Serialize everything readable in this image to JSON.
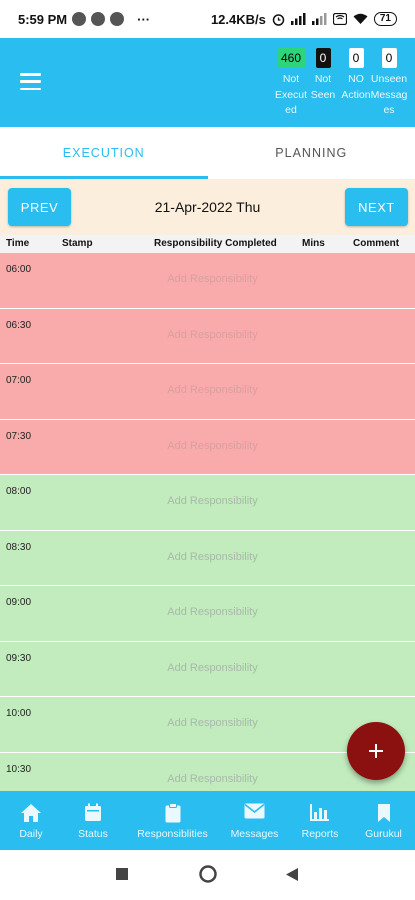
{
  "status_bar": {
    "time": "5:59 PM",
    "more": "···",
    "network_speed": "12.4KB/s",
    "battery": "71"
  },
  "header": {
    "stats": [
      {
        "count": "460",
        "label_line1": "Not",
        "label_line2": "Execut",
        "label_line3": "ed",
        "badge_color": "#2ed47a"
      },
      {
        "count": "0",
        "label_line1": "Not",
        "label_line2": "Seen",
        "label_line3": "",
        "badge_color": "#111111"
      },
      {
        "count": "0",
        "label_line1": "NO",
        "label_line2": "Action",
        "label_line3": "",
        "badge_color": "#ffffff"
      },
      {
        "count": "0",
        "label_line1": "Unseen",
        "label_line2": "Messag",
        "label_line3": "es",
        "badge_color": "#ffffff"
      }
    ]
  },
  "tabs": [
    {
      "label": "EXECUTION",
      "active": true
    },
    {
      "label": "PLANNING",
      "active": false
    }
  ],
  "date_nav": {
    "prev_label": "PREV",
    "next_label": "NEXT",
    "date": "21-Apr-2022 Thu"
  },
  "columns": {
    "time": "Time",
    "stamp": "Stamp",
    "responsibility": "Responsibility Completed",
    "mins": "Mins",
    "comment": "Comment"
  },
  "slots": [
    {
      "time": "06:00",
      "placeholder": "Add Responsibility",
      "status": "overdue"
    },
    {
      "time": "06:30",
      "placeholder": "Add Responsibility",
      "status": "overdue"
    },
    {
      "time": "07:00",
      "placeholder": "Add Responsibility",
      "status": "overdue"
    },
    {
      "time": "07:30",
      "placeholder": "Add Responsibility",
      "status": "overdue"
    },
    {
      "time": "08:00",
      "placeholder": "Add Responsibility",
      "status": "open"
    },
    {
      "time": "08:30",
      "placeholder": "Add Responsibility",
      "status": "open"
    },
    {
      "time": "09:00",
      "placeholder": "Add Responsibility",
      "status": "open"
    },
    {
      "time": "09:30",
      "placeholder": "Add Responsibility",
      "status": "open"
    },
    {
      "time": "10:00",
      "placeholder": "Add Responsibility",
      "status": "open"
    },
    {
      "time": "10:30",
      "placeholder": "Add Responsibility",
      "status": "open"
    }
  ],
  "bottom_nav": [
    {
      "label": "Daily",
      "icon": "home-icon"
    },
    {
      "label": "Status",
      "icon": "calendar-icon"
    },
    {
      "label": "Responsiblities",
      "icon": "clipboard-icon"
    },
    {
      "label": "Messages",
      "icon": "mail-icon"
    },
    {
      "label": "Reports",
      "icon": "bar-chart-icon"
    },
    {
      "label": "Gurukul",
      "icon": "bookmark-icon"
    }
  ],
  "colors": {
    "primary": "#29bdf0",
    "overdue_row": "#f9aaaa",
    "open_row": "#c2ecbe",
    "fab": "#8b1010",
    "date_bar": "#fbeedd"
  }
}
